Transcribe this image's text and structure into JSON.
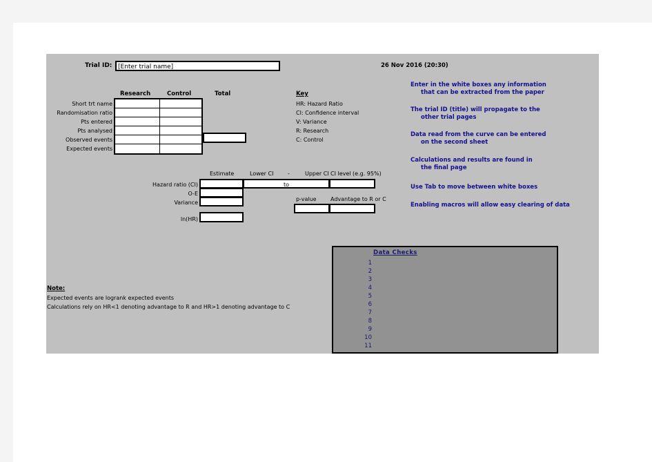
{
  "header": {
    "trial_id_label": "Trial ID:",
    "trial_id_value": "[Enter trial name]",
    "timestamp": "26 Nov 2016 (20:30)"
  },
  "table": {
    "columns": [
      "Research",
      "Control",
      "Total"
    ],
    "rows": [
      "Short trt name",
      "Randomisation ratio",
      "Pts entered",
      "Pts analysed",
      "Observed events",
      "Expected events"
    ],
    "values": {
      "research": [
        "",
        "",
        "",
        "",
        "",
        ""
      ],
      "control": [
        "",
        "",
        "",
        "",
        "",
        ""
      ],
      "total_observed": ""
    }
  },
  "key": {
    "title": "Key",
    "entries": [
      "HR: Hazard Ratio",
      "CI: Confidence interval",
      "V: Variance",
      "R: Research",
      "C: Control"
    ]
  },
  "instructions": [
    "Enter in the white boxes any information",
    "that can be extracted from the paper",
    "The trial ID (title) will propagate to the",
    "other trial pages",
    "Data read from the curve can be entered",
    "on the second sheet",
    "Calculations and results are found in",
    "the final page",
    "Use Tab to move between white boxes",
    "Enabling macros will allow easy clearing of data"
  ],
  "hazard": {
    "col_estimate": "Estimate",
    "col_lower_ci": "Lower CI",
    "col_dash": "-",
    "col_upper_ci": "Upper CI",
    "col_ci_level": "CI level (e.g. 95%)",
    "row_hr_label": "Hazard ratio (CI)",
    "row_oe_label": "O-E",
    "row_variance_label": "Variance",
    "row_lnhr_label": "ln(HR)",
    "to_word": "to",
    "pvalue_label": "p-value",
    "advantage_label": "Advantage to R or C",
    "values": {
      "hr_estimate": "",
      "hr_ci": "",
      "ci_level": "",
      "oe": "",
      "variance": "",
      "lnhr": "",
      "pvalue": "",
      "advantage": ""
    }
  },
  "data_checks": {
    "title": "Data Checks",
    "numbers": [
      "1",
      "2",
      "3",
      "4",
      "5",
      "6",
      "7",
      "8",
      "9",
      "10",
      "11"
    ],
    "messages": [
      "",
      "",
      "",
      "",
      "",
      "",
      "",
      "",
      "",
      "",
      ""
    ]
  },
  "note": {
    "title": "Note:",
    "lines": [
      "Expected events are  logrank expected events",
      "Calculations rely on HR<1 denoting advantage to R and HR>1 denoting advantage to C"
    ]
  },
  "colors": {
    "panel_bg": "#c0c0c0",
    "page_bg": "#ffffff",
    "chrome": "#f4f4f4",
    "accent_blue": "#11118e",
    "datachecks_bg": "#929292",
    "text": "#000000"
  }
}
